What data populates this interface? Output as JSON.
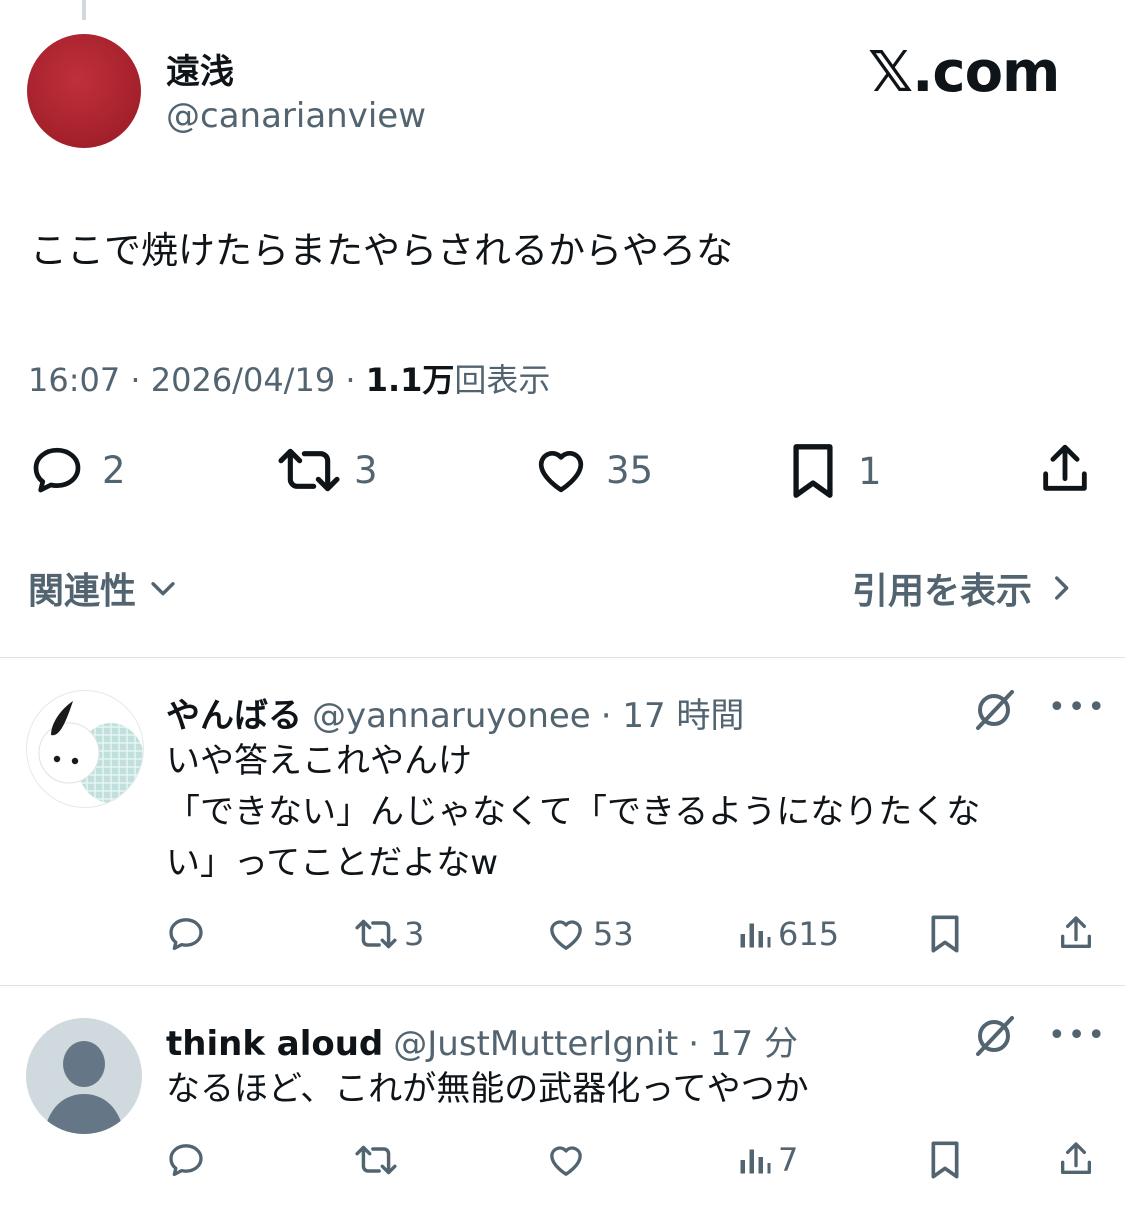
{
  "brand": {
    "logo_text": "𝕏.com"
  },
  "tweet": {
    "author_name": "遠浅",
    "author_handle": "@canarianview",
    "text": "ここで焼けたらまたやらされるからやろな",
    "time": "16:07 · 2026/04/19 · ",
    "views_count": "1.1万",
    "views_label": "回表示",
    "actions": {
      "replies": "2",
      "retweets": "3",
      "likes": "35",
      "bookmarks": "1"
    }
  },
  "sections": {
    "relevance": "関連性",
    "quotes": "引用を表示"
  },
  "replies": [
    {
      "name": "やんばる",
      "handle": "@yannaruyonee",
      "time": "· 17 時間",
      "line1": "いや答えこれやんけ",
      "line2": "「できない」んじゃなくて「できるようになりたくな",
      "line3": "い」ってことだよなw",
      "retweets": "3",
      "likes": "53",
      "views": "615"
    },
    {
      "name": "think aloud",
      "handle": "@JustMutterIgnit",
      "time": "· 17 分",
      "line1": "なるほど、これが無能の武器化ってやつか",
      "retweets": "",
      "likes": "",
      "views": "7"
    }
  ],
  "icons": [
    "reply-icon",
    "retweet-icon",
    "like-icon",
    "bookmark-icon",
    "share-icon",
    "views-icon",
    "grok-icon",
    "more-icon",
    "chevron-down-icon",
    "chevron-right-icon"
  ],
  "colors": {
    "text": "#0f1419",
    "secondary": "#536471",
    "avatar": "#a3202b"
  }
}
